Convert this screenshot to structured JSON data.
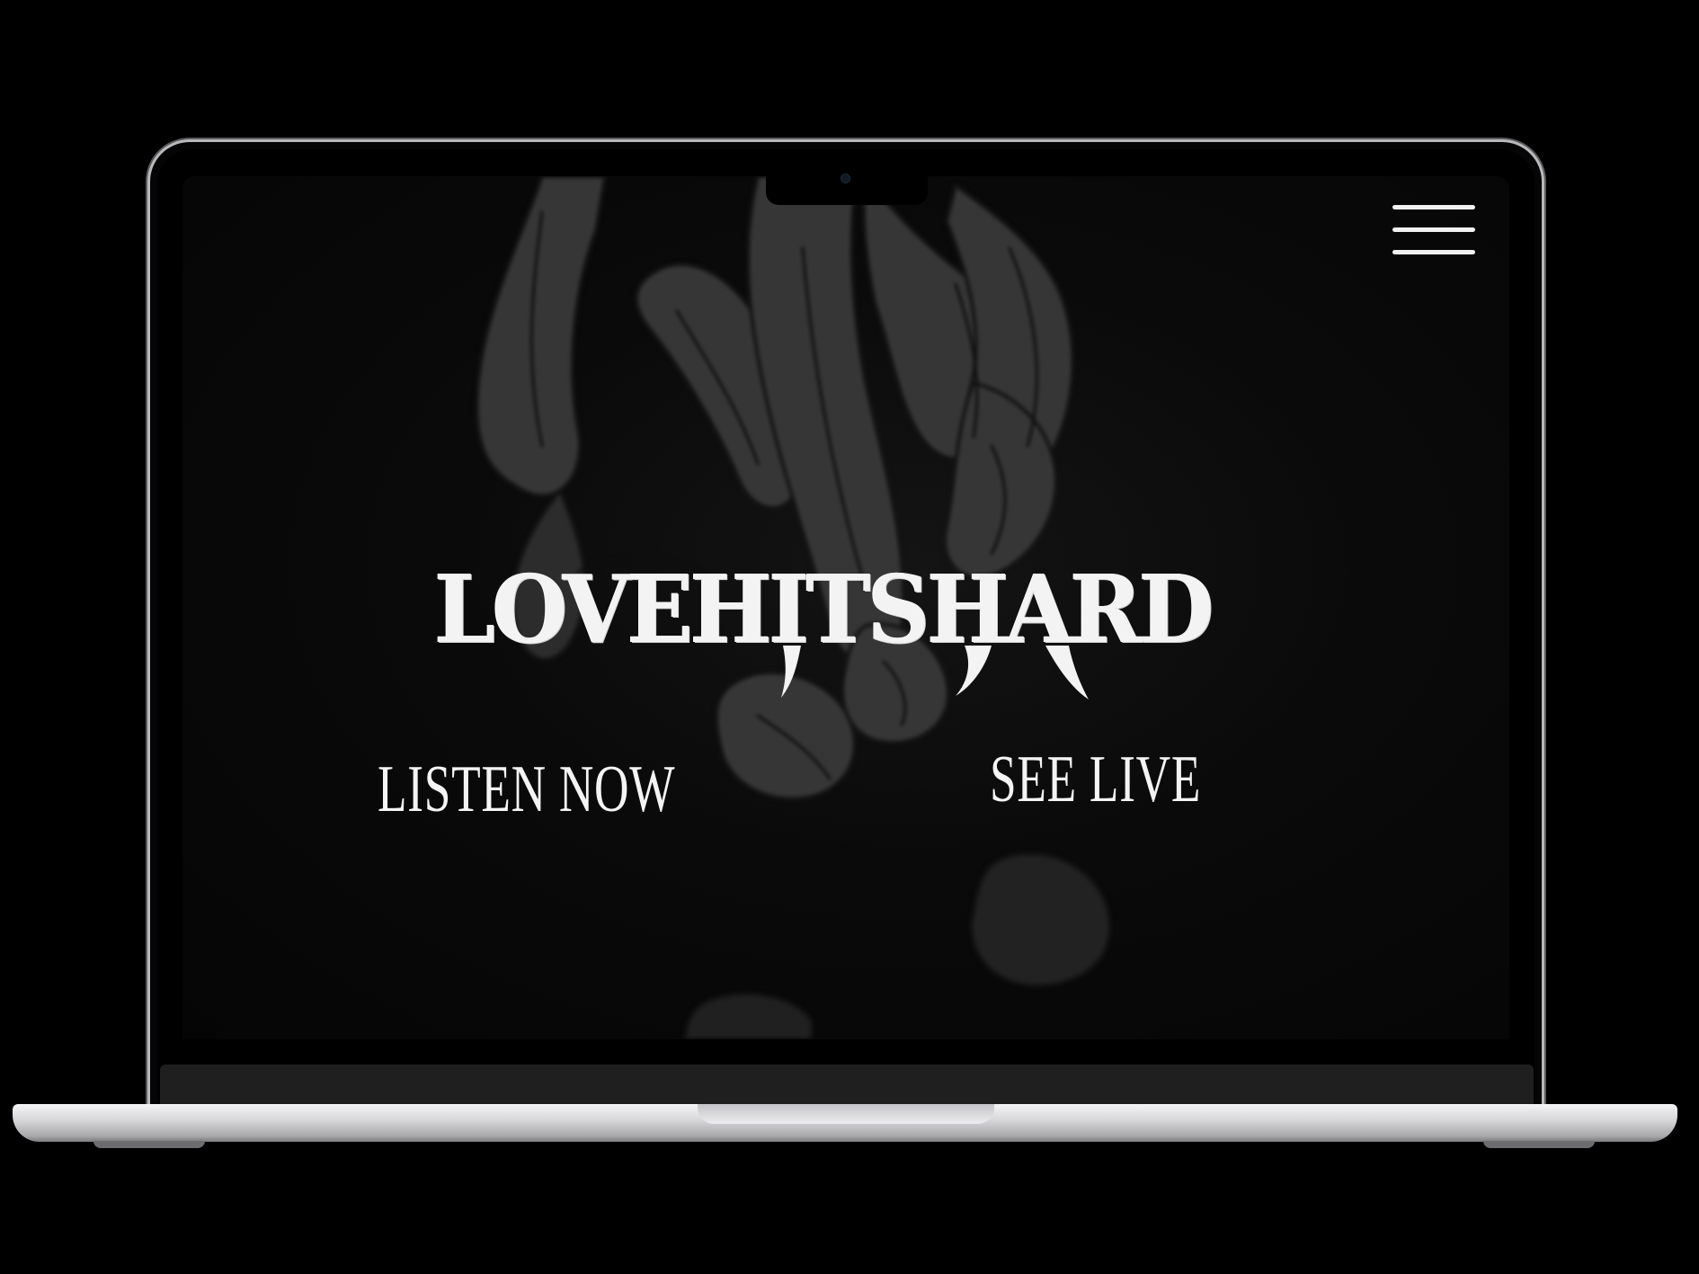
{
  "site": {
    "brand_name": "LOVEHITSHARD",
    "menu_icon": "hamburger-menu-icon"
  },
  "actions": {
    "listen_label": "LISTEN NOW",
    "live_label": "SEE LIVE"
  },
  "colors": {
    "background": "#000000",
    "screen_background": "#0a0a0a",
    "text": "#f3f3f3",
    "artwork_gray": "#3a3a3a",
    "laptop_silver": "#d9d9dc"
  },
  "device": {
    "type": "laptop-mockup"
  }
}
